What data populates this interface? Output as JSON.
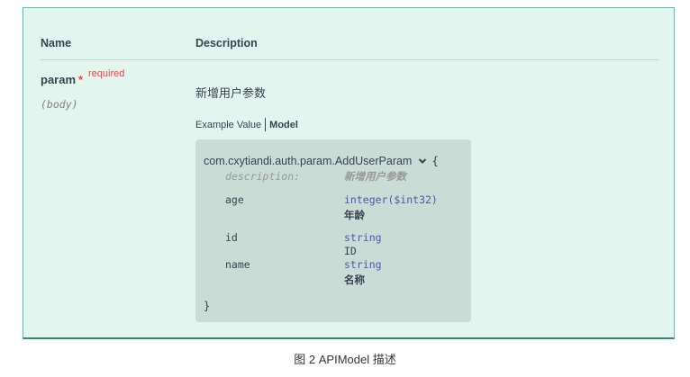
{
  "table": {
    "header_name": "Name",
    "header_description": "Description"
  },
  "param": {
    "name": "param",
    "star": "*",
    "required_label": "required",
    "location": "(body)",
    "description": "新增用户参数"
  },
  "tabs": {
    "example_value": "Example Value",
    "model": "Model"
  },
  "model": {
    "title": "com.cxytiandi.auth.param.AddUserParam",
    "brace_open": "{",
    "brace_close": "}",
    "description_key": "description:",
    "description_value": "新增用户参数",
    "properties": [
      {
        "name": "age",
        "type": "integer($int32)",
        "description": "年龄"
      },
      {
        "name": "id",
        "type": "string",
        "description": "ID"
      },
      {
        "name": "name",
        "type": "string",
        "description": "名称"
      }
    ]
  },
  "caption": "图 2  APIModel 描述",
  "colors": {
    "panel_bg": "#e2f5ee",
    "panel_border": "#49cc90",
    "model_bg": "#c9dcd5",
    "required": "#f93e3e",
    "type": "#5555aa"
  },
  "icons": {
    "expand": "chevron-down-icon"
  }
}
